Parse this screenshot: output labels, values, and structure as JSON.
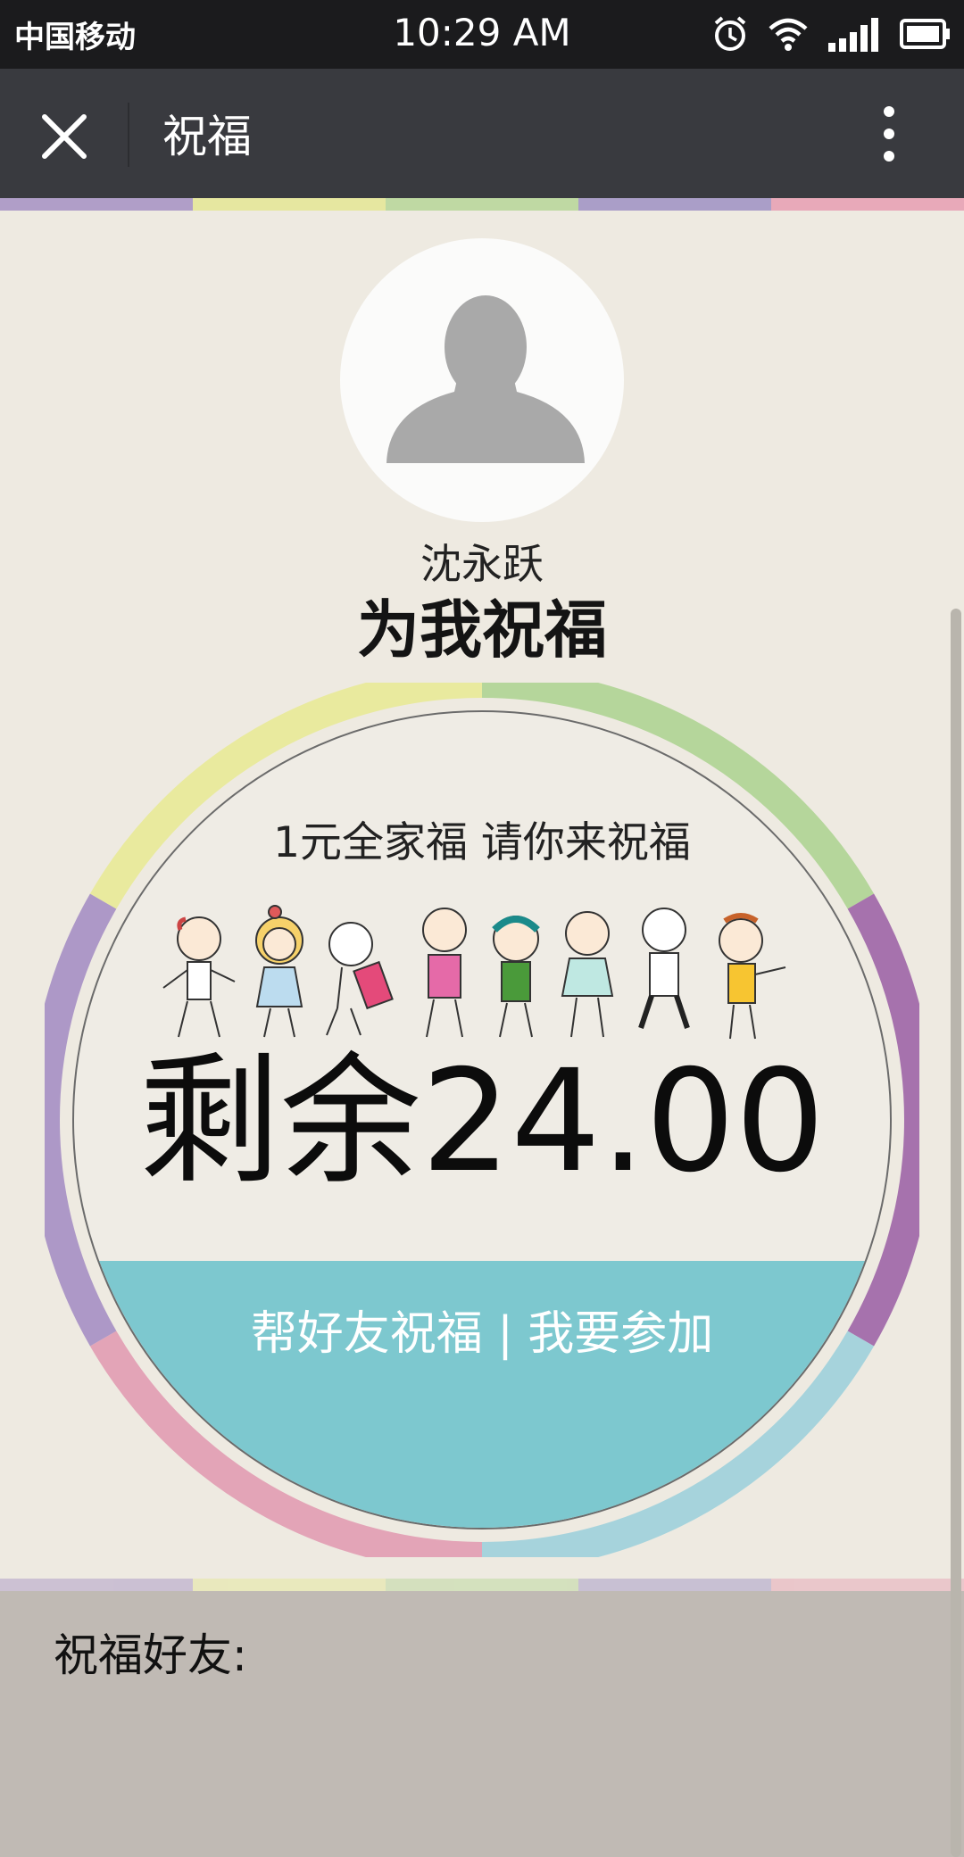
{
  "status_bar": {
    "carrier": "中国移动",
    "time": "10:29 AM",
    "icons": [
      "alarm-icon",
      "wifi-icon",
      "signal-icon",
      "battery-icon"
    ]
  },
  "nav": {
    "title": "祝福",
    "close_icon": "close-icon",
    "more_icon": "more-vertical-icon"
  },
  "profile": {
    "name": "沈永跃",
    "headline": "为我祝福"
  },
  "card": {
    "subtitle": "1元全家福 请你来祝福",
    "remaining": "剩余24.00",
    "action": "帮好友祝福 | 我要参加",
    "ring_colors": [
      "#b5d69b",
      "#a672ad",
      "#a6d3dc",
      "#e3a4b7",
      "#ad98c7",
      "#e9ea9e"
    ],
    "button_color": "#7dc8cf"
  },
  "friends": {
    "label": "祝福好友:"
  },
  "stripe_colors": [
    "#b09ec8",
    "#e6e7a0",
    "#bfd9a3",
    "#aa9ec8",
    "#e8a9b9"
  ]
}
